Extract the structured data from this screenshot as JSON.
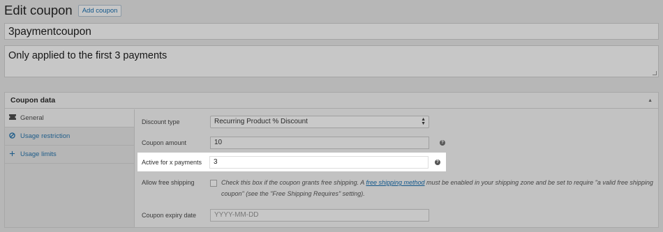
{
  "header": {
    "title": "Edit coupon",
    "add_button": "Add coupon"
  },
  "coupon_code": "3paymentcoupon",
  "description": "Only applied to the first 3 payments",
  "panel": {
    "title": "Coupon data",
    "tabs": [
      {
        "label": "General",
        "icon": "ticket-icon"
      },
      {
        "label": "Usage restriction",
        "icon": "block-icon"
      },
      {
        "label": "Usage limits",
        "icon": "plus-icon"
      }
    ]
  },
  "fields": {
    "discount_type": {
      "label": "Discount type",
      "value": "Recurring Product % Discount"
    },
    "coupon_amount": {
      "label": "Coupon amount",
      "value": "10"
    },
    "active_payments": {
      "label": "Active for x payments",
      "value": "3"
    },
    "free_shipping": {
      "label": "Allow free shipping",
      "text_before": "Check this box if the coupon grants free shipping. A ",
      "link": "free shipping method",
      "text_after": " must be enabled in your shipping zone and be set to require \"a valid free shipping coupon\" (see the \"Free Shipping Requires\" setting).",
      "checked": false
    },
    "expiry_date": {
      "label": "Coupon expiry date",
      "placeholder": "YYYY-MM-DD"
    }
  },
  "colors": {
    "link": "#10568a",
    "highlight": "#ffffff",
    "overlay": "#b7b7b7"
  }
}
